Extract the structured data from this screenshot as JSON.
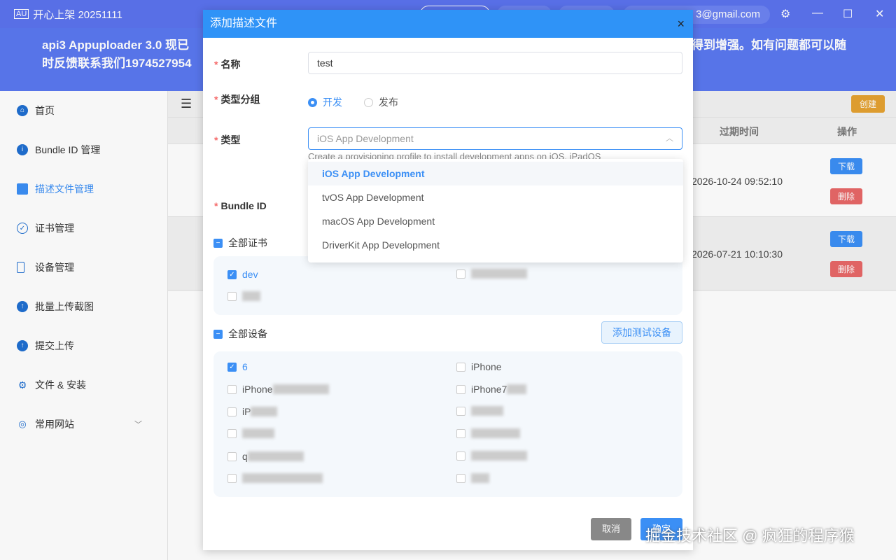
{
  "app": {
    "logo": "AU",
    "title": "开心上架 20251111",
    "email": "3@gmail.com"
  },
  "banner": {
    "line1": "api3 Appuploader 3.0 现已",
    "line1_end": "得到增强。如有问题都可以随",
    "line2": "时反馈联系我们19745279​54"
  },
  "sidebar": {
    "items": [
      {
        "label": "首页",
        "icon": "home-icon"
      },
      {
        "label": "Bundle ID 管理",
        "icon": "info-icon"
      },
      {
        "label": "描述文件管理",
        "icon": "file-icon"
      },
      {
        "label": "证书管理",
        "icon": "badge-check-icon"
      },
      {
        "label": "设备管理",
        "icon": "phone-icon"
      },
      {
        "label": "批量上传截图",
        "icon": "upload-icon"
      },
      {
        "label": "提交上传",
        "icon": "upload-icon"
      },
      {
        "label": "文件 & 安装",
        "icon": "gear-sync-icon"
      },
      {
        "label": "常用网站",
        "icon": "location-icon"
      }
    ]
  },
  "content": {
    "create": "创建",
    "headers": {
      "expire": "过期时间",
      "action": "操作"
    },
    "rows": [
      {
        "expire": "2026-10-24 09:52:10",
        "download": "下载",
        "delete": "删除"
      },
      {
        "expire": "2026-07-21 10:10:30",
        "download": "下载",
        "delete": "删除"
      }
    ]
  },
  "dialog": {
    "title": "添加描述文件",
    "close": "×",
    "name_label": "名称",
    "name_value": "test",
    "group_label": "类型分组",
    "group_options": [
      "开发",
      "发布"
    ],
    "type_label": "类型",
    "type_value": "iOS App Development",
    "type_hint": "Create a provisioning profile to install development apps on iOS, iPadOS",
    "type_options": [
      "iOS App Development",
      "tvOS App Development",
      "macOS App Development",
      "DriverKit App Development"
    ],
    "bundle_label": "Bundle ID",
    "all_certs": "全部证书",
    "certs": [
      "dev"
    ],
    "all_devices": "全部设备",
    "add_device": "添加测试设备",
    "devices": [
      "6",
      "iPhone",
      "iPhone",
      "iPhone7",
      "iP",
      "q"
    ],
    "cancel": "取消",
    "confirm": "确定"
  },
  "watermark": "掘金技术社区 @ 疯狂的程序猴",
  "colors": {
    "primary": "#3b8ff5",
    "header": "#5b73ee",
    "warning": "#e5a231",
    "danger": "#f56c6c"
  }
}
